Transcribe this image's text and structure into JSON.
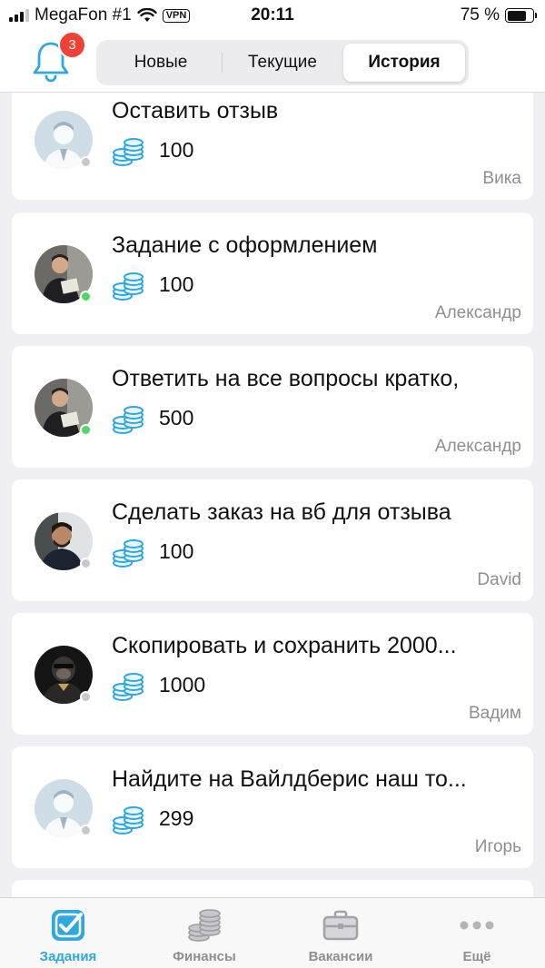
{
  "status_bar": {
    "carrier": "MegaFon #1",
    "vpn": "VPN",
    "time": "20:11",
    "battery": "75 %",
    "battery_level": 0.75
  },
  "header": {
    "notifications_count": "3",
    "tabs": [
      {
        "label": "Новые",
        "active": false
      },
      {
        "label": "Текущие",
        "active": false
      },
      {
        "label": "История",
        "active": true
      }
    ]
  },
  "tasks": [
    {
      "title": "Оставить отзыв",
      "amount": "100",
      "author": "Вика",
      "online": false,
      "avatar": "default-avatar"
    },
    {
      "title": "Задание с оформлением",
      "amount": "100",
      "author": "Александр",
      "online": true,
      "avatar": "user-photo"
    },
    {
      "title": "Ответить на все вопросы кратко,",
      "amount": "500",
      "author": "Александр",
      "online": true,
      "avatar": "user-photo"
    },
    {
      "title": "Сделать заказ на вб для отзыва",
      "amount": "100",
      "author": "David",
      "online": false,
      "avatar": "user-photo"
    },
    {
      "title": "Скопировать и сохранить 2000...",
      "amount": "1000",
      "author": "Вадим",
      "online": false,
      "avatar": "user-photo"
    },
    {
      "title": "Найдите на Вайлдберис наш то...",
      "amount": "299",
      "author": "Игорь",
      "online": false,
      "avatar": "default-avatar"
    }
  ],
  "tabbar": [
    {
      "label": "Задания",
      "icon": "tasks-check-icon",
      "active": true
    },
    {
      "label": "Финансы",
      "icon": "coins-icon",
      "active": false
    },
    {
      "label": "Вакансии",
      "icon": "briefcase-icon",
      "active": false
    },
    {
      "label": "Ещё",
      "icon": "more-dots-icon",
      "active": false
    }
  ],
  "colors": {
    "accent": "#2fa8e0",
    "badge": "#ef4135",
    "online": "#4cd964",
    "offline": "#c7c7cc"
  }
}
